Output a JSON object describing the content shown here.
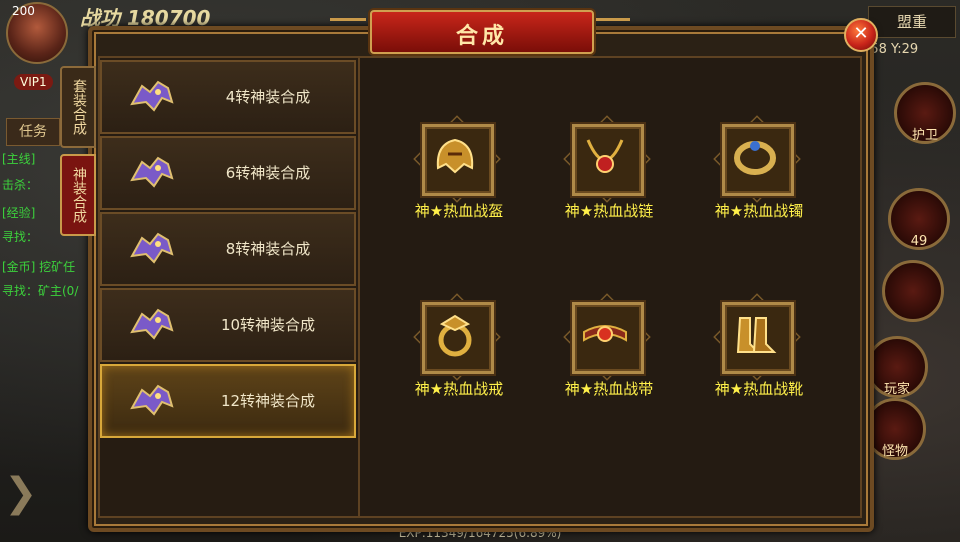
{
  "hud": {
    "level": "200",
    "power_label": "战功",
    "power_value": "180700",
    "vip": "VIP1",
    "quest_tab": "任务",
    "quest_lines": [
      "[主线]",
      "击杀：",
      "[经验]",
      "寻找：",
      "[金币] 挖矿任",
      "寻找：矿主(0/"
    ],
    "alliance": "盟重",
    "coords": ":58 Y:29",
    "guard_label": "护卫",
    "skill_count": "49",
    "player_label": "玩家",
    "monster_label": "怪物",
    "exp": "EXP:11349/164725(6.89%)"
  },
  "dialog": {
    "title": "合成",
    "close_icon": "close-x-icon",
    "tabs": [
      {
        "label": "套装合成",
        "active": false
      },
      {
        "label": "神装合成",
        "active": true
      }
    ],
    "list": [
      {
        "label": "4转神装合成",
        "icon": "dragon-emblem-icon",
        "selected": false
      },
      {
        "label": "6转神装合成",
        "icon": "dragon-emblem-icon",
        "selected": false
      },
      {
        "label": "8转神装合成",
        "icon": "dragon-emblem-icon",
        "selected": false
      },
      {
        "label": "10转神装合成",
        "icon": "dragon-emblem-icon",
        "selected": false
      },
      {
        "label": "12转神装合成",
        "icon": "dragon-emblem-icon",
        "selected": true
      }
    ],
    "items": [
      {
        "label": "神★热血战盔",
        "icon": "helmet-icon"
      },
      {
        "label": "神★热血战链",
        "icon": "necklace-icon"
      },
      {
        "label": "神★热血战镯",
        "icon": "bracelet-icon"
      },
      {
        "label": "神★热血战戒",
        "icon": "ring-icon"
      },
      {
        "label": "神★热血战带",
        "icon": "belt-icon"
      },
      {
        "label": "神★热血战靴",
        "icon": "boots-icon"
      }
    ]
  },
  "colors": {
    "item_label": "#fff04a",
    "frame_gold": "#b08a48",
    "selected_border": "#d8a83a",
    "title_red": "#c8261a"
  }
}
